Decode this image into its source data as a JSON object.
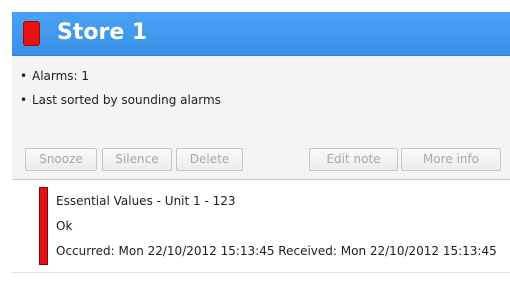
{
  "header": {
    "title": "Store 1",
    "status_color": "#e81010",
    "background": "#3a8fe6"
  },
  "info": {
    "items": [
      "Alarms: 1",
      "Last sorted by sounding alarms"
    ]
  },
  "toolbar": {
    "snooze": "Snooze",
    "silence": "Silence",
    "delete": "Delete",
    "edit_note": "Edit note",
    "more_info": "More info"
  },
  "alarm": {
    "title": "Essential Values - Unit 1 - 123",
    "status": "Ok",
    "times": "Occurred: Mon 22/10/2012 15:13:45  Received: Mon 22/10/2012 15:13:45",
    "severity_color": "#e01414"
  }
}
